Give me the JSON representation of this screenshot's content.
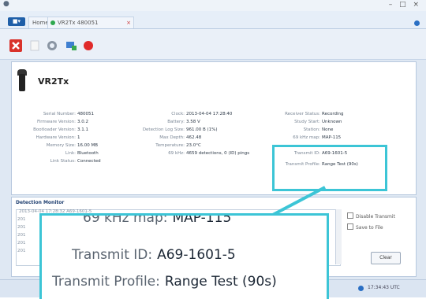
{
  "window": {
    "home_tab": "Home",
    "receiver_tab": "VR2Tx 480051",
    "status_time": "17:34:43 UTC"
  },
  "device": {
    "model": "VR2Tx",
    "col1": [
      {
        "label": "Serial Number:",
        "value": "480051"
      },
      {
        "label": "Firmware Version:",
        "value": "3.0.2"
      },
      {
        "label": "Bootloader Version:",
        "value": "3.1.1"
      },
      {
        "label": "Hardware Version:",
        "value": "1"
      },
      {
        "label": "Memory Size:",
        "value": "16.00 MB"
      },
      {
        "label": "Link:",
        "value": "Bluetooth"
      },
      {
        "label": "Link Status:",
        "value": "Connected"
      }
    ],
    "col2": [
      {
        "label": "Clock:",
        "value": "2013-04-04 17:28:40"
      },
      {
        "label": "Battery:",
        "value": "3.58 V"
      },
      {
        "label": "Detection Log Size:",
        "value": "961.00 B (1%)"
      },
      {
        "label": "Max Depth:",
        "value": "462.48"
      },
      {
        "label": "Temperature:",
        "value": "23.0°C"
      },
      {
        "label": "69 kHz:",
        "value": "4659 detections, 0 (ID) pings"
      }
    ],
    "col3": [
      {
        "label": "Receiver Status:",
        "value": "Recording"
      },
      {
        "label": "Study Start:",
        "value": "Unknown"
      },
      {
        "label": "Station:",
        "value": "None"
      },
      {
        "label": "69 kHz map:",
        "value": "MAP-115"
      },
      {
        "label": "Transmit ID:",
        "value": "A69-1601-5"
      },
      {
        "label": "Transmit Profile:",
        "value": "Range Test (90s)"
      }
    ]
  },
  "detections": {
    "title": "Detection Monitor",
    "first_line": "2013-04-04 17:28:32 A69-1601-5",
    "stubs": [
      "201",
      "201",
      "201",
      "201",
      "201"
    ],
    "disable_transmit": "Disable Transmit",
    "save_to_file": "Save to File",
    "clear_button": "Clear"
  },
  "zoom": {
    "rows": [
      {
        "label": "69 kHz map:",
        "value": "MAP-115"
      },
      {
        "label": "Transmit ID:",
        "value": "A69-1601-5"
      },
      {
        "label": "Transmit Profile:",
        "value": "Range Test (90s)"
      }
    ]
  },
  "colors": {
    "highlight": "#3cc5d6",
    "accent": "#1f5fa8"
  },
  "icons": [
    "close-receiver-icon",
    "blank-icon",
    "settings-icon",
    "connect-icon",
    "record-icon"
  ]
}
